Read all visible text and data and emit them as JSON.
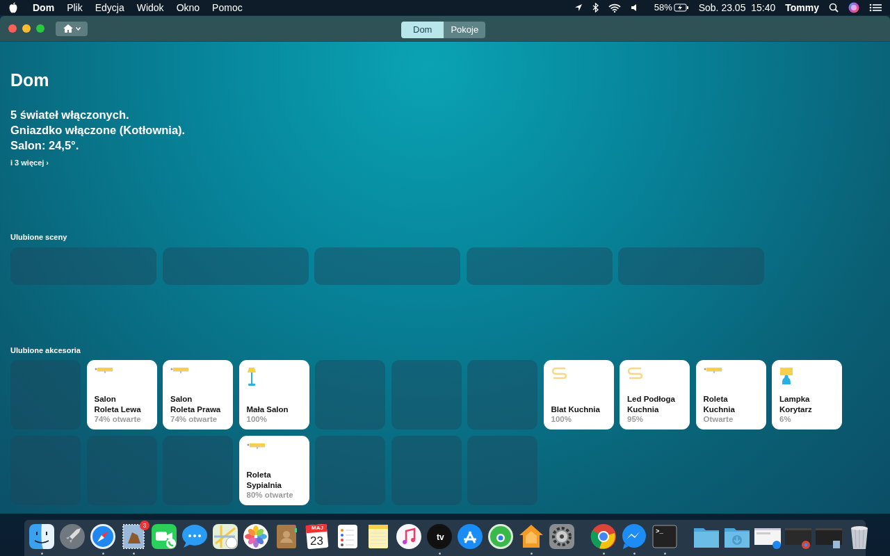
{
  "menubar": {
    "menus": [
      {
        "label": "Dom",
        "kind": "app"
      },
      {
        "label": "Plik",
        "kind": "menu"
      },
      {
        "label": "Edycja",
        "kind": "menu"
      },
      {
        "label": "Widok",
        "kind": "menu"
      },
      {
        "label": "Okno",
        "kind": "menu"
      },
      {
        "label": "Pomoc",
        "kind": "menu"
      }
    ],
    "battery": "58%",
    "clock": "Sob. 23.05  15:40",
    "user": "Tommy"
  },
  "toolbar": {
    "tabs": [
      {
        "label": "Dom",
        "selected": true
      },
      {
        "label": "Pokoje",
        "selected": false
      }
    ]
  },
  "home": {
    "title": "Dom",
    "summary": [
      "5 świateł włączonych.",
      "Gniazdko włączone (Kotłownia).",
      "Salon: 24,5°."
    ],
    "more": "i 3 więcej ›"
  },
  "scenes": {
    "heading": "Ulubione sceny",
    "tiles": [
      {
        "kind": "empty"
      },
      {
        "kind": "empty"
      },
      {
        "kind": "empty"
      },
      {
        "kind": "empty"
      },
      {
        "kind": "empty"
      }
    ]
  },
  "accessories": {
    "heading": "Ulubione akcesoria",
    "rows": [
      [
        {
          "kind": "empty"
        },
        {
          "kind": "blind",
          "name": "Salon\nRoleta Lewa",
          "status": "74% otwarte"
        },
        {
          "kind": "blind",
          "name": "Salon\nRoleta Prawa",
          "status": "74% otwarte"
        },
        {
          "kind": "floor-lamp",
          "name": "Mała Salon",
          "status": "100%"
        },
        {
          "kind": "empty"
        },
        {
          "kind": "empty"
        },
        {
          "kind": "empty"
        },
        {
          "kind": "strip",
          "name": "Blat Kuchnia",
          "status": "100%"
        },
        {
          "kind": "strip",
          "name": "Led Podłoga\nKuchnia",
          "status": "95%"
        },
        {
          "kind": "blind",
          "name": "Roleta\nKuchnia",
          "status": "Otwarte"
        },
        {
          "kind": "table-lamp",
          "name": "Lampka\nKorytarz",
          "status": "6%"
        }
      ],
      [
        {
          "kind": "empty"
        },
        {
          "kind": "empty"
        },
        {
          "kind": "empty"
        },
        {
          "kind": "blind",
          "name": "Roleta\nSypialnia",
          "status": "80% otwarte"
        },
        {
          "kind": "empty"
        },
        {
          "kind": "empty"
        },
        {
          "kind": "empty"
        }
      ]
    ]
  },
  "dock": [
    {
      "kind": "finder",
      "running": true
    },
    {
      "kind": "rocket",
      "running": false
    },
    {
      "kind": "compass",
      "running": true
    },
    {
      "kind": "stamp",
      "running": true,
      "badge": "3"
    },
    {
      "kind": "video",
      "running": false
    },
    {
      "kind": "chat",
      "running": false
    },
    {
      "kind": "map",
      "running": false
    },
    {
      "kind": "flower",
      "running": false
    },
    {
      "kind": "book",
      "running": false
    },
    {
      "kind": "calendar",
      "running": false,
      "month": "MAJ",
      "day": "23"
    },
    {
      "kind": "checklist",
      "running": false
    },
    {
      "kind": "notepad",
      "running": false
    },
    {
      "kind": "music",
      "running": false
    },
    {
      "kind": "tv",
      "running": true,
      "label": "tv"
    },
    {
      "kind": "a-shape",
      "running": false
    },
    {
      "kind": "target",
      "running": false
    },
    {
      "kind": "house",
      "running": true
    },
    {
      "kind": "gear",
      "running": false
    },
    {
      "kind": "separator"
    },
    {
      "kind": "ring",
      "running": true
    },
    {
      "kind": "bolt",
      "running": true
    },
    {
      "kind": "terminal",
      "running": true,
      "label": ">_"
    },
    {
      "kind": "separator"
    },
    {
      "kind": "folder",
      "running": false
    },
    {
      "kind": "download-folder",
      "running": false
    },
    {
      "kind": "thumb-compass",
      "running": false
    },
    {
      "kind": "thumb-ring",
      "running": false
    },
    {
      "kind": "thumb-stamp",
      "running": false
    },
    {
      "kind": "trash",
      "running": false
    }
  ]
}
